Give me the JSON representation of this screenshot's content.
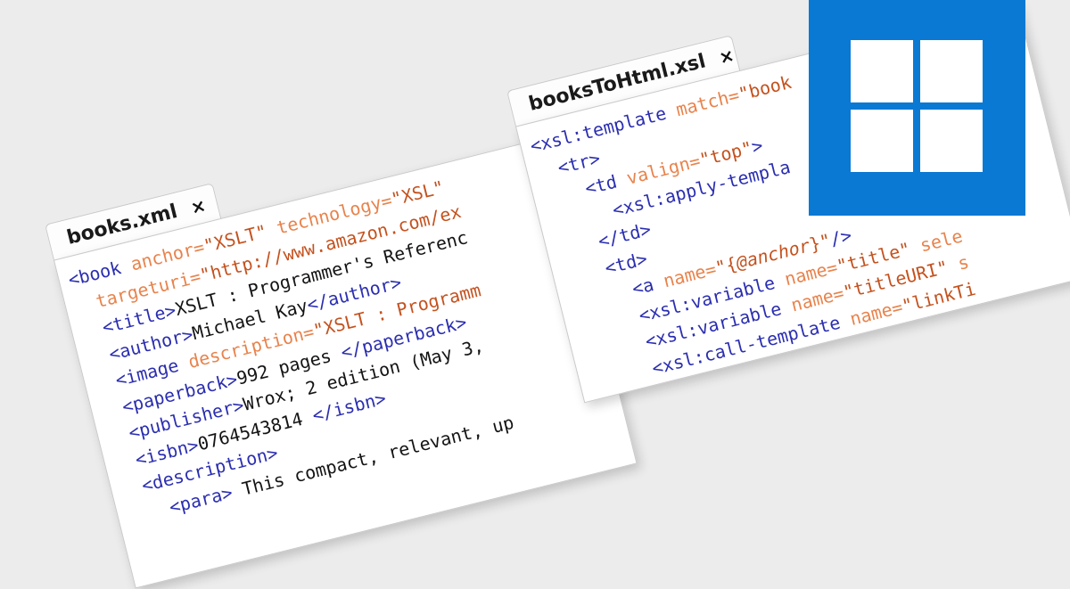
{
  "left_editor": {
    "tab_label": "books.xml",
    "close_label": "×",
    "lines": [
      [
        {
          "c": "tg",
          "t": "<book "
        },
        {
          "c": "at",
          "t": "anchor="
        },
        {
          "c": "vl",
          "t": "\"XSLT\" "
        },
        {
          "c": "at",
          "t": "technology="
        },
        {
          "c": "vl",
          "t": "\"XSL\""
        }
      ],
      [
        {
          "c": "at",
          "t": "  targeturi="
        },
        {
          "c": "vl",
          "t": "\"http://www.amazon.com/ex"
        }
      ],
      [
        {
          "c": "tg",
          "t": "  <title>"
        },
        {
          "c": "tx",
          "t": "XSLT : Programmer's Referenc"
        }
      ],
      [
        {
          "c": "tg",
          "t": "  <author>"
        },
        {
          "c": "tx",
          "t": "Michael Kay"
        },
        {
          "c": "tg",
          "t": "</author>"
        }
      ],
      [
        {
          "c": "tg",
          "t": "  <image "
        },
        {
          "c": "at",
          "t": "description="
        },
        {
          "c": "vl",
          "t": "\"XSLT : Programm"
        }
      ],
      [
        {
          "c": "tg",
          "t": "  <paperback>"
        },
        {
          "c": "tx",
          "t": "992 pages "
        },
        {
          "c": "tg",
          "t": "</paperback>"
        }
      ],
      [
        {
          "c": "tg",
          "t": "  <publisher>"
        },
        {
          "c": "tx",
          "t": "Wrox; 2 edition (May 3,"
        }
      ],
      [
        {
          "c": "tg",
          "t": "  <isbn>"
        },
        {
          "c": "tx",
          "t": "0764543814 "
        },
        {
          "c": "tg",
          "t": "</isbn>"
        }
      ],
      [
        {
          "c": "tg",
          "t": "  <description>"
        }
      ],
      [
        {
          "c": "tg",
          "t": "    <para> "
        },
        {
          "c": "tx",
          "t": "This compact, relevant, up"
        }
      ]
    ]
  },
  "right_editor": {
    "tab_label": "booksToHtml.xsl",
    "close_label": "×",
    "lines": [
      [
        {
          "c": "tg",
          "t": "<xsl:template "
        },
        {
          "c": "at",
          "t": "match="
        },
        {
          "c": "vl",
          "t": "\"book"
        }
      ],
      [
        {
          "c": "tg",
          "t": "  <tr>"
        }
      ],
      [
        {
          "c": "tg",
          "t": "    <td "
        },
        {
          "c": "at",
          "t": "valign="
        },
        {
          "c": "vl",
          "t": "\"top\""
        },
        {
          "c": "tg",
          "t": ">"
        }
      ],
      [
        {
          "c": "tg",
          "t": "      <xsl:apply-templa"
        }
      ],
      [
        {
          "c": "tg",
          "t": "    </td>"
        }
      ],
      [
        {
          "c": "tg",
          "t": "    <td>"
        }
      ],
      [
        {
          "c": "tg",
          "t": "      <a "
        },
        {
          "c": "at",
          "t": "name="
        },
        {
          "c": "vl",
          "t": "\"{"
        },
        {
          "c": "ex",
          "t": "@anchor"
        },
        {
          "c": "vl",
          "t": "}\""
        },
        {
          "c": "tg",
          "t": "/>"
        }
      ],
      [
        {
          "c": "tg",
          "t": "      <xsl:variable "
        },
        {
          "c": "at",
          "t": "name="
        },
        {
          "c": "vl",
          "t": "\"title\" "
        },
        {
          "c": "at",
          "t": "sele"
        }
      ],
      [
        {
          "c": "tg",
          "t": "      <xsl:variable "
        },
        {
          "c": "at",
          "t": "name="
        },
        {
          "c": "vl",
          "t": "\"titleURI\" "
        },
        {
          "c": "at",
          "t": "s"
        }
      ],
      [
        {
          "c": "tg",
          "t": "      <xsl:call-template "
        },
        {
          "c": "at",
          "t": "name="
        },
        {
          "c": "vl",
          "t": "\"linkTi"
        }
      ]
    ]
  },
  "windows_badge": {
    "icon": "windows-logo-icon",
    "background": "#0a79d4"
  }
}
